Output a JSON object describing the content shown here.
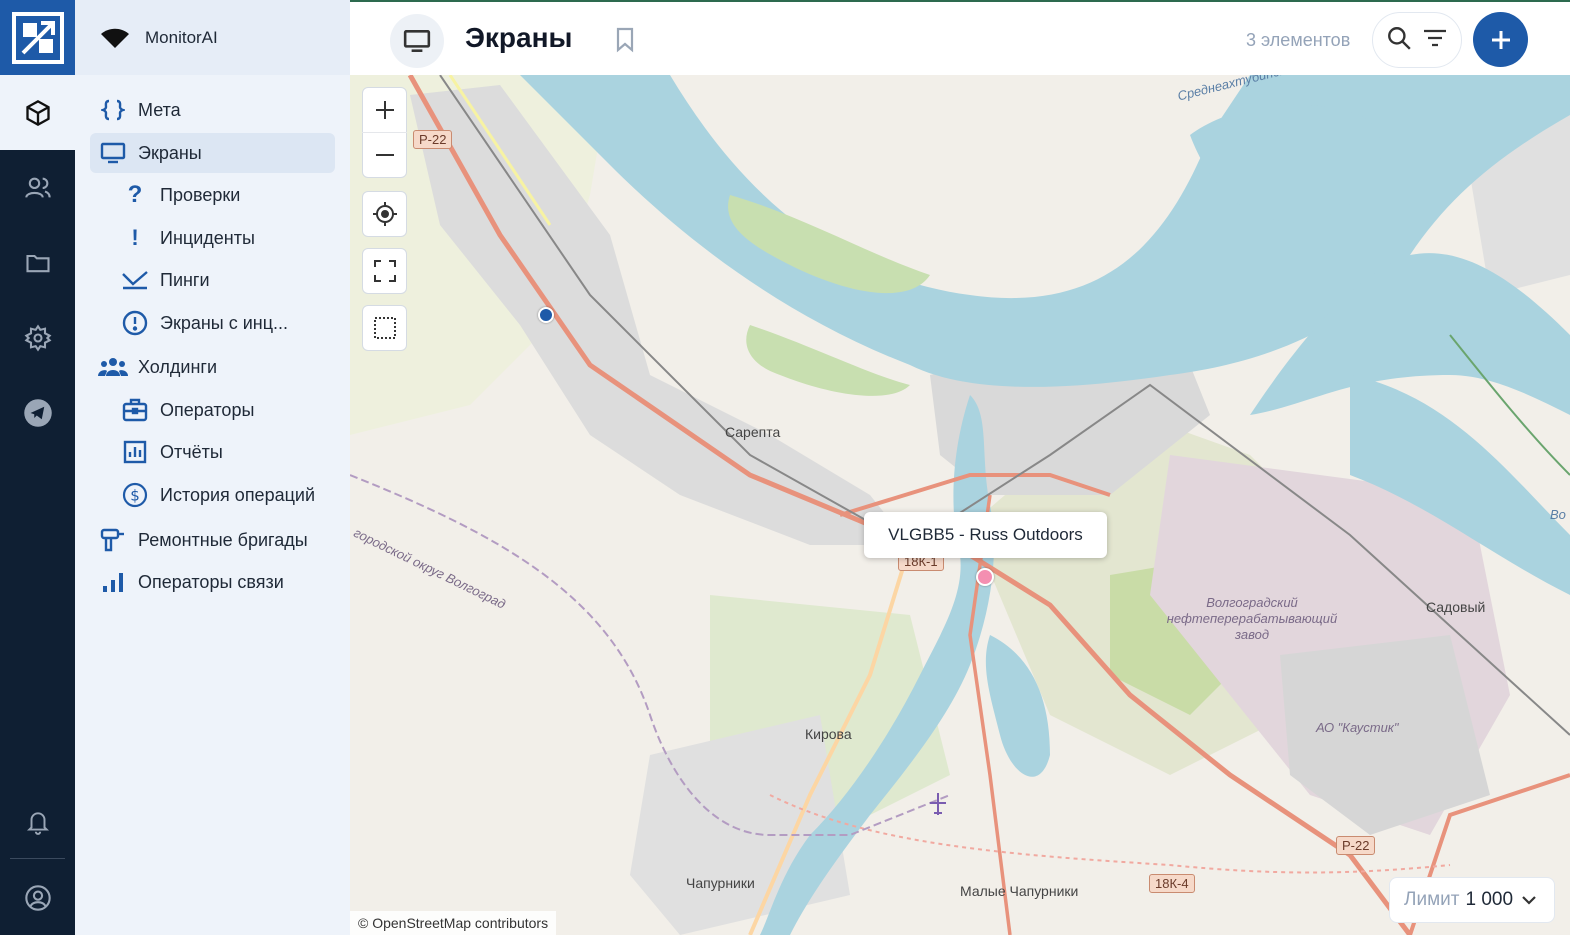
{
  "brand": {
    "app_name": "MonitorAI",
    "logo_icon": "monitorai-logo-icon",
    "accent": "#1e5aa8"
  },
  "rail": {
    "items": [
      {
        "icon": "cube-icon",
        "active": true
      },
      {
        "icon": "users-icon"
      },
      {
        "icon": "folder-icon"
      },
      {
        "icon": "gear-icon"
      },
      {
        "icon": "telegram-icon"
      },
      {
        "icon": "bell-icon"
      },
      {
        "icon": "user-circle-icon"
      }
    ]
  },
  "sidebar": {
    "items": [
      {
        "label": "Мета",
        "icon": "braces-icon",
        "level": 1
      },
      {
        "label": "Экраны",
        "icon": "monitor-icon",
        "level": 1,
        "active": true
      },
      {
        "label": "Проверки",
        "icon": "question-icon",
        "level": 2
      },
      {
        "label": "Инциденты",
        "icon": "exclamation-icon",
        "level": 2
      },
      {
        "label": "Пинги",
        "icon": "ping-icon",
        "level": 2
      },
      {
        "label": "Экраны с инц...",
        "icon": "alert-circle-icon",
        "level": 2
      },
      {
        "label": "Холдинги",
        "icon": "group-icon",
        "level": 1
      },
      {
        "label": "Операторы",
        "icon": "briefcase-icon",
        "level": 2
      },
      {
        "label": "Отчёты",
        "icon": "bar-chart-icon",
        "level": 2
      },
      {
        "label": "История операций",
        "icon": "dollar-circle-icon",
        "level": 2
      },
      {
        "label": "Ремонтные бригады",
        "icon": "drill-icon",
        "level": 1
      },
      {
        "label": "Операторы связи",
        "icon": "signal-icon",
        "level": 1
      }
    ]
  },
  "header": {
    "title": "Экраны",
    "count": "3 элементов",
    "icons": [
      "monitor-icon",
      "bookmark-icon",
      "search-icon",
      "filter-icon",
      "plus-icon"
    ]
  },
  "map": {
    "labels": {
      "sarepta": "Сарепта",
      "kirova": "Кирова",
      "chapurniki": "Чапурники",
      "malye_chapurniki": "Малые Чапурники",
      "sadovy": "Садовый",
      "refinery": "Волгоградский нефтеперерабатывающий завод",
      "kaustik": "АО \"Каустик\"",
      "gorodskoy_okrug": "городской округ Волгоград",
      "raion": "Среднеахтубинский район",
      "vo": "Во"
    },
    "roads": {
      "r22_top": "Р-22",
      "r22_bottom": "Р-22",
      "k18_1": "18К-1",
      "k18_4": "18К-4"
    },
    "tooltip": "VLGBB5 - Russ Outdoors",
    "attribution": "© OpenStreetMap contributors",
    "limit_label": "Лимит",
    "limit_value": "1 000",
    "controls": [
      "zoom-in-icon",
      "zoom-out-icon",
      "locate-icon",
      "fullscreen-icon",
      "select-area-icon"
    ]
  }
}
